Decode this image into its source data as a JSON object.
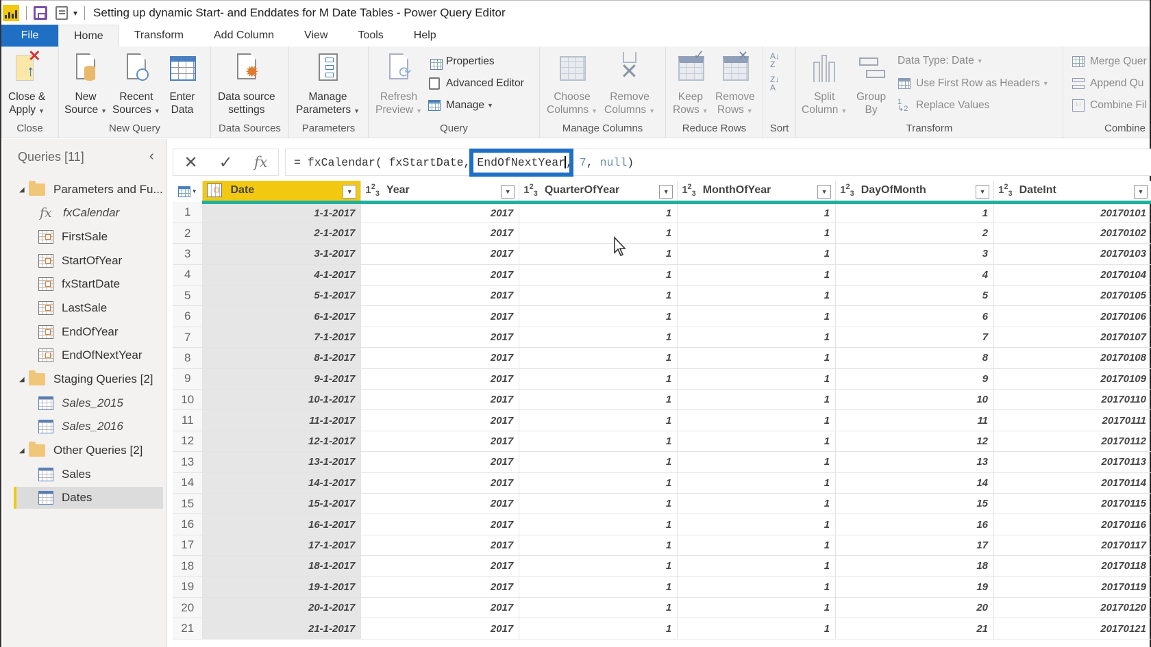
{
  "window": {
    "title": "Setting up dynamic Start- and Enddates for M Date Tables - Power Query Editor"
  },
  "menu_tabs": [
    {
      "label": "File"
    },
    {
      "label": "Home"
    },
    {
      "label": "Transform"
    },
    {
      "label": "Add Column"
    },
    {
      "label": "View"
    },
    {
      "label": "Tools"
    },
    {
      "label": "Help"
    }
  ],
  "active_tab": "Home",
  "ribbon": {
    "groups": {
      "close": "Close",
      "new_query": "New Query",
      "data_sources": "Data Sources",
      "parameters": "Parameters",
      "query": "Query",
      "manage_columns": "Manage Columns",
      "reduce_rows": "Reduce Rows",
      "sort": "Sort",
      "transform": "Transform",
      "combine": "Combine"
    },
    "buttons": {
      "close_apply": [
        "Close &",
        "Apply"
      ],
      "new_source": [
        "New",
        "Source"
      ],
      "recent_sources": [
        "Recent",
        "Sources"
      ],
      "enter_data": [
        "Enter",
        "Data"
      ],
      "data_source_settings": [
        "Data source",
        "settings"
      ],
      "manage_parameters": [
        "Manage",
        "Parameters"
      ],
      "refresh_preview": [
        "Refresh",
        "Preview"
      ],
      "properties": "Properties",
      "advanced_editor": "Advanced Editor",
      "manage": "Manage",
      "choose_columns": [
        "Choose",
        "Columns"
      ],
      "remove_columns": [
        "Remove",
        "Columns"
      ],
      "keep_rows": [
        "Keep",
        "Rows"
      ],
      "remove_rows": [
        "Remove",
        "Rows"
      ],
      "split_column": [
        "Split",
        "Column"
      ],
      "group_by": [
        "Group",
        "By"
      ],
      "data_type": "Data Type: Date",
      "use_first_row": "Use First Row as Headers",
      "replace_values": "Replace Values",
      "merge_queries": "Merge Quer",
      "append_queries": "Append Qu",
      "combine_files": "Combine Fil"
    }
  },
  "queries_panel": {
    "title": "Queries [11]",
    "groups": [
      {
        "name": "Parameters and Fu...",
        "items": [
          {
            "name": "fxCalendar",
            "type": "function"
          },
          {
            "name": "FirstSale",
            "type": "parameter"
          },
          {
            "name": "StartOfYear",
            "type": "parameter"
          },
          {
            "name": "fxStartDate",
            "type": "parameter"
          },
          {
            "name": "LastSale",
            "type": "parameter"
          },
          {
            "name": "EndOfYear",
            "type": "parameter"
          },
          {
            "name": "EndOfNextYear",
            "type": "parameter"
          }
        ]
      },
      {
        "name": "Staging Queries [2]",
        "items": [
          {
            "name": "Sales_2015",
            "type": "table"
          },
          {
            "name": "Sales_2016",
            "type": "table"
          }
        ]
      },
      {
        "name": "Other Queries [2]",
        "items": [
          {
            "name": "Sales",
            "type": "table"
          },
          {
            "name": "Dates",
            "type": "table",
            "selected": true
          }
        ]
      }
    ]
  },
  "formula_bar": {
    "prefix": "= fxCalendar( fxStartDate, ",
    "highlighted": "EndOfNextYear",
    "comma": ",",
    "arg3": " 7",
    "sep": ", ",
    "arg4": "null",
    "suffix": ")"
  },
  "table": {
    "columns": [
      {
        "name": "Date",
        "type": "date"
      },
      {
        "name": "Year",
        "type": "int"
      },
      {
        "name": "QuarterOfYear",
        "type": "int"
      },
      {
        "name": "MonthOfYear",
        "type": "int"
      },
      {
        "name": "DayOfMonth",
        "type": "int"
      },
      {
        "name": "DateInt",
        "type": "int"
      }
    ],
    "type_label": {
      "int_a": "1",
      "int_b": "2",
      "int_c": "3"
    },
    "rows": [
      [
        "1",
        "1-1-2017",
        "2017",
        "1",
        "1",
        "1",
        "20170101"
      ],
      [
        "2",
        "2-1-2017",
        "2017",
        "1",
        "1",
        "2",
        "20170102"
      ],
      [
        "3",
        "3-1-2017",
        "2017",
        "1",
        "1",
        "3",
        "20170103"
      ],
      [
        "4",
        "4-1-2017",
        "2017",
        "1",
        "1",
        "4",
        "20170104"
      ],
      [
        "5",
        "5-1-2017",
        "2017",
        "1",
        "1",
        "5",
        "20170105"
      ],
      [
        "6",
        "6-1-2017",
        "2017",
        "1",
        "1",
        "6",
        "20170106"
      ],
      [
        "7",
        "7-1-2017",
        "2017",
        "1",
        "1",
        "7",
        "20170107"
      ],
      [
        "8",
        "8-1-2017",
        "2017",
        "1",
        "1",
        "8",
        "20170108"
      ],
      [
        "9",
        "9-1-2017",
        "2017",
        "1",
        "1",
        "9",
        "20170109"
      ],
      [
        "10",
        "10-1-2017",
        "2017",
        "1",
        "1",
        "10",
        "20170110"
      ],
      [
        "11",
        "11-1-2017",
        "2017",
        "1",
        "1",
        "11",
        "20170111"
      ],
      [
        "12",
        "12-1-2017",
        "2017",
        "1",
        "1",
        "12",
        "20170112"
      ],
      [
        "13",
        "13-1-2017",
        "2017",
        "1",
        "1",
        "13",
        "20170113"
      ],
      [
        "14",
        "14-1-2017",
        "2017",
        "1",
        "1",
        "14",
        "20170114"
      ],
      [
        "15",
        "15-1-2017",
        "2017",
        "1",
        "1",
        "15",
        "20170115"
      ],
      [
        "16",
        "16-1-2017",
        "2017",
        "1",
        "1",
        "16",
        "20170116"
      ],
      [
        "17",
        "17-1-2017",
        "2017",
        "1",
        "1",
        "17",
        "20170117"
      ],
      [
        "18",
        "18-1-2017",
        "2017",
        "1",
        "1",
        "18",
        "20170118"
      ],
      [
        "19",
        "19-1-2017",
        "2017",
        "1",
        "1",
        "19",
        "20170119"
      ],
      [
        "20",
        "20-1-2017",
        "2017",
        "1",
        "1",
        "20",
        "20170120"
      ],
      [
        "21",
        "21-1-2017",
        "2017",
        "1",
        "1",
        "21",
        "20170121"
      ]
    ]
  },
  "colors": {
    "accent_blue": "#1f6fc5",
    "selected_column": "#f2c811",
    "quality_bar": "#20b0a0"
  }
}
